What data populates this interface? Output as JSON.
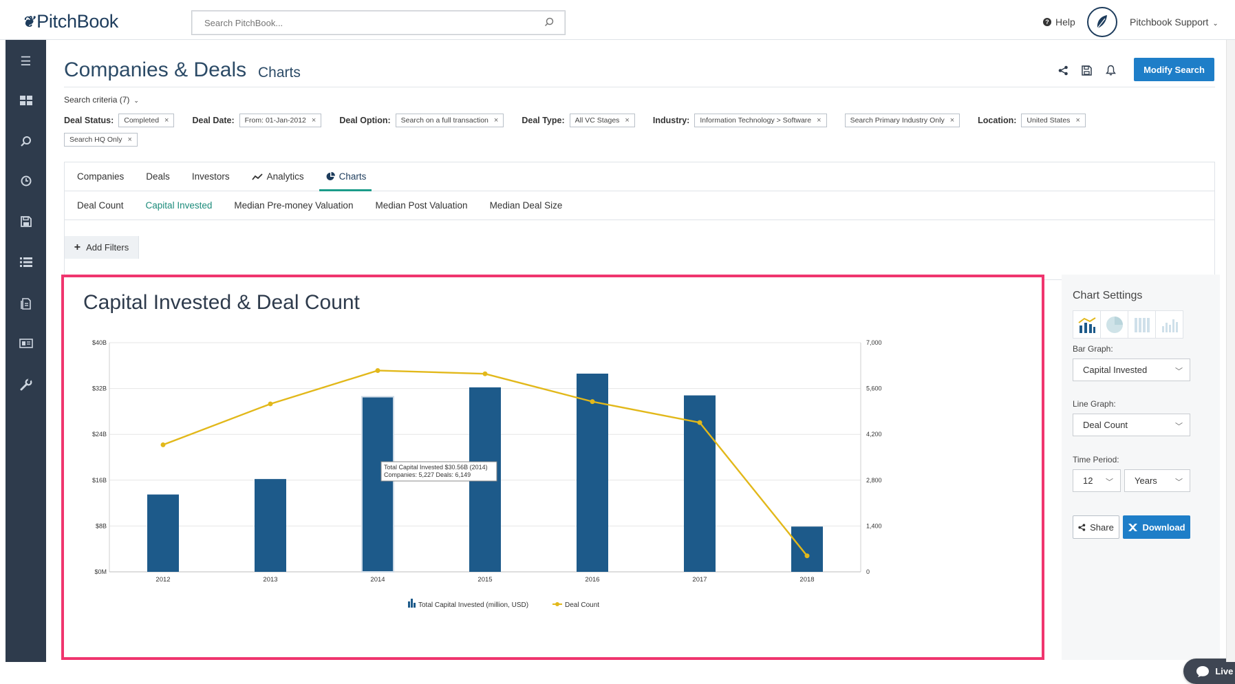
{
  "brand": {
    "name": "PitchBook"
  },
  "search": {
    "placeholder": "Search PitchBook..."
  },
  "header": {
    "help": "Help",
    "user": "Pitchbook Support"
  },
  "page": {
    "title": "Companies & Deals",
    "subtitle": "Charts",
    "modify_button": "Modify Search"
  },
  "criteria": {
    "toggle": "Search criteria (7)",
    "filters": [
      {
        "label": "Deal Status:",
        "chips": [
          "Completed"
        ]
      },
      {
        "label": "Deal Date:",
        "chips": [
          "From: 01-Jan-2012"
        ]
      },
      {
        "label": "Deal Option:",
        "chips": [
          "Search on a full transaction"
        ]
      },
      {
        "label": "Deal Type:",
        "chips": [
          "All VC Stages"
        ]
      },
      {
        "label": "Industry:",
        "chips": [
          "Information Technology > Software",
          "Search Primary Industry Only"
        ]
      },
      {
        "label": "Location:",
        "chips": [
          "United States",
          "Search HQ Only"
        ]
      }
    ]
  },
  "tabs": {
    "primary": [
      "Companies",
      "Deals",
      "Investors",
      "Analytics",
      "Charts"
    ],
    "secondary": [
      "Deal Count",
      "Capital Invested",
      "Median Pre-money Valuation",
      "Median Post Valuation",
      "Median Deal Size"
    ],
    "add_filters": "Add Filters"
  },
  "chart_data": {
    "type": "bar",
    "title": "Capital Invested & Deal Count",
    "categories": [
      "2012",
      "2013",
      "2014",
      "2015",
      "2016",
      "2017",
      "2018"
    ],
    "series": [
      {
        "name": "Total Capital Invested (million, USD)",
        "type": "bar",
        "axis": "left",
        "color": "#1d5a8a",
        "values": [
          13500,
          16200,
          30560,
          32200,
          34600,
          30800,
          7900
        ]
      },
      {
        "name": "Deal Count",
        "type": "line",
        "axis": "right",
        "color": "#e2b81a",
        "values": [
          3880,
          5130,
          6149,
          6050,
          5200,
          4560,
          490
        ]
      }
    ],
    "y_left": {
      "ticks": [
        "$0M",
        "$8B",
        "$16B",
        "$24B",
        "$32B",
        "$40B"
      ],
      "range": [
        0,
        40000
      ]
    },
    "y_right": {
      "ticks": [
        "0",
        "1,400",
        "2,800",
        "4,200",
        "5,600",
        "7,000"
      ],
      "range": [
        0,
        7000
      ]
    },
    "tooltip": {
      "line1": "Total Capital Invested $30.56B (2014)",
      "line2": "Companies: 5,227 Deals: 6,149"
    },
    "legend": [
      "Total Capital Invested (million, USD)",
      "Deal Count"
    ]
  },
  "settings": {
    "title": "Chart Settings",
    "bar_label": "Bar Graph:",
    "bar_value": "Capital Invested",
    "line_label": "Line Graph:",
    "line_value": "Deal Count",
    "period_label": "Time Period:",
    "period_value": "12",
    "period_unit": "Years",
    "share": "Share",
    "download": "Download"
  },
  "livechat": "Live chat"
}
